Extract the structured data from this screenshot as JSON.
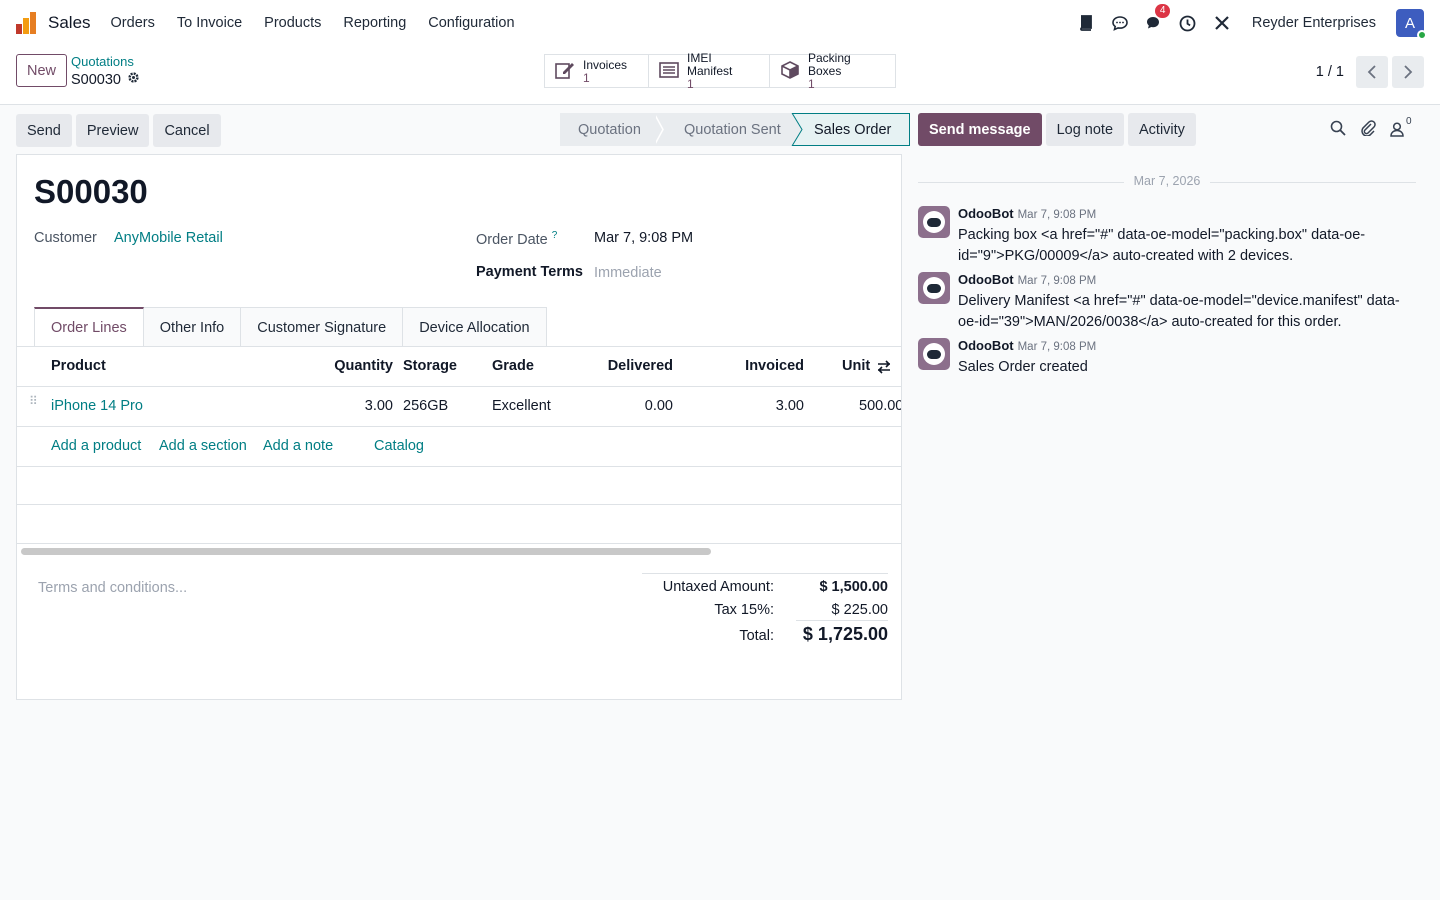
{
  "navbar": {
    "app_name": "Sales",
    "menu": [
      "Orders",
      "To Invoice",
      "Products",
      "Reporting",
      "Configuration"
    ],
    "messages_badge": "4",
    "company": "Reyder Enterprises",
    "avatar_letter": "A"
  },
  "control": {
    "new_label": "New",
    "breadcrumb": "Quotations",
    "record": "S00030",
    "smart_buttons": [
      {
        "label": "Invoices",
        "count": "1",
        "icon": "edit-icon"
      },
      {
        "label": "IMEI Manifest",
        "count": "1",
        "icon": "list-icon"
      },
      {
        "label": "Packing Boxes",
        "count": "1",
        "icon": "box-icon"
      }
    ],
    "pager": "1 / 1"
  },
  "actions": {
    "send": "Send",
    "preview": "Preview",
    "cancel": "Cancel"
  },
  "stages": [
    "Quotation",
    "Quotation Sent",
    "Sales Order"
  ],
  "form": {
    "title": "S00030",
    "customer_label": "Customer",
    "customer_value": "AnyMobile Retail",
    "order_date_label": "Order Date",
    "order_date_help": "?",
    "order_date_value": "Mar 7, 9:08 PM",
    "payment_terms_label": "Payment Terms",
    "payment_terms_value": "Immediate",
    "tabs": [
      "Order Lines",
      "Other Info",
      "Customer Signature",
      "Device Allocation"
    ],
    "columns": {
      "product": "Product",
      "quantity": "Quantity",
      "storage": "Storage",
      "grade": "Grade",
      "delivered": "Delivered",
      "invoiced": "Invoiced",
      "unit": "Unit"
    },
    "lines": [
      {
        "product": "iPhone 14 Pro",
        "quantity": "3.00",
        "storage": "256GB",
        "grade": "Excellent",
        "delivered": "0.00",
        "invoiced": "3.00",
        "unit": "500.00"
      }
    ],
    "add_links": {
      "product": "Add a product",
      "section": "Add a section",
      "note": "Add a note",
      "catalog": "Catalog"
    },
    "terms_placeholder": "Terms and conditions...",
    "totals": {
      "untaxed_label": "Untaxed Amount:",
      "untaxed_value": "$ 1,500.00",
      "tax_label": "Tax 15%:",
      "tax_value": "$ 225.00",
      "total_label": "Total:",
      "total_value": "$ 1,725.00"
    }
  },
  "chatter": {
    "send_message": "Send message",
    "log_note": "Log note",
    "activity": "Activity",
    "followers_count": "0",
    "date_separator": "Mar 7, 2026",
    "messages": [
      {
        "author": "OdooBot",
        "time": "Mar 7, 9:08 PM",
        "body": "Packing box <a href=\"#\" data-oe-model=\"packing.box\" data-oe-id=\"9\">PKG/00009</a> auto-created with 2 devices."
      },
      {
        "author": "OdooBot",
        "time": "Mar 7, 9:08 PM",
        "body": "Delivery Manifest <a href=\"#\" data-oe-model=\"device.manifest\" data-oe-id=\"39\">MAN/2026/0038</a> auto-created for this order."
      },
      {
        "author": "OdooBot",
        "time": "Mar 7, 9:08 PM",
        "body": "Sales Order created"
      }
    ]
  },
  "colors": {
    "brand": "#714b67",
    "link": "#017e84",
    "badge": "#dc3545"
  }
}
